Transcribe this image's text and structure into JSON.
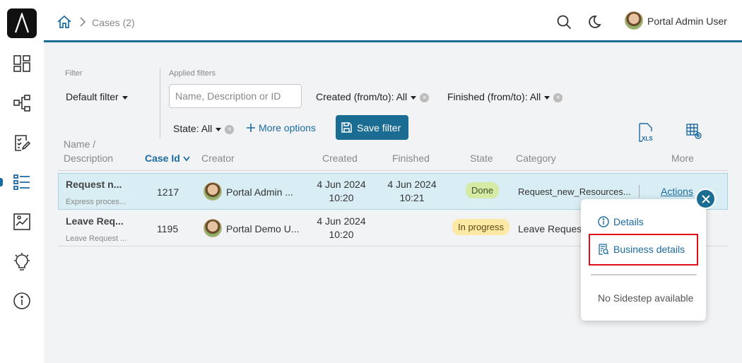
{
  "header": {
    "breadcrumb": "Cases (2)",
    "user_name": "Portal Admin User"
  },
  "sidebar": {
    "items": [
      "dashboard-icon",
      "process-icon",
      "tasks-icon",
      "cases-icon",
      "statistics-icon",
      "ideas-icon",
      "info-icon"
    ],
    "active": "cases-icon"
  },
  "filter": {
    "filter_label": "Filter",
    "filter_value": "Default filter",
    "applied_label": "Applied filters",
    "search_placeholder": "Name, Description or ID",
    "created": "Created (from/to): All",
    "finished": "Finished (from/to): All",
    "state": "State: All",
    "more_options": "More options",
    "save_filter": "Save filter"
  },
  "table": {
    "columns": {
      "name_line1": "Name /",
      "name_line2": "Description",
      "case_id": "Case Id",
      "creator": "Creator",
      "created": "Created",
      "finished": "Finished",
      "state": "State",
      "category": "Category",
      "more": "More"
    },
    "rows": [
      {
        "name": "Request n...",
        "desc": "Express proces...",
        "case_id": "1217",
        "creator": "Portal Admin ...",
        "created_date": "4 Jun 2024",
        "created_time": "10:20",
        "finished_date": "4 Jun 2024",
        "finished_time": "10:21",
        "state": "Done",
        "category": "Request_new_Resources...",
        "actions": "Actions"
      },
      {
        "name": "Leave Req...",
        "desc": "Leave Request ...",
        "case_id": "1195",
        "creator": "Portal Demo U...",
        "created_date": "4 Jun 2024",
        "created_time": "10:20",
        "finished_date": "",
        "finished_time": "",
        "state": "In progress",
        "category": "Leave Request"
      }
    ]
  },
  "actions_menu": {
    "details": "Details",
    "business_details": "Business details",
    "no_sidestep": "No Sidestep available"
  },
  "colors": {
    "primary": "#1b6c93",
    "done_badge": "#d4eaa5",
    "in_progress_badge": "#fde9a6",
    "highlight": "#e0101a"
  }
}
